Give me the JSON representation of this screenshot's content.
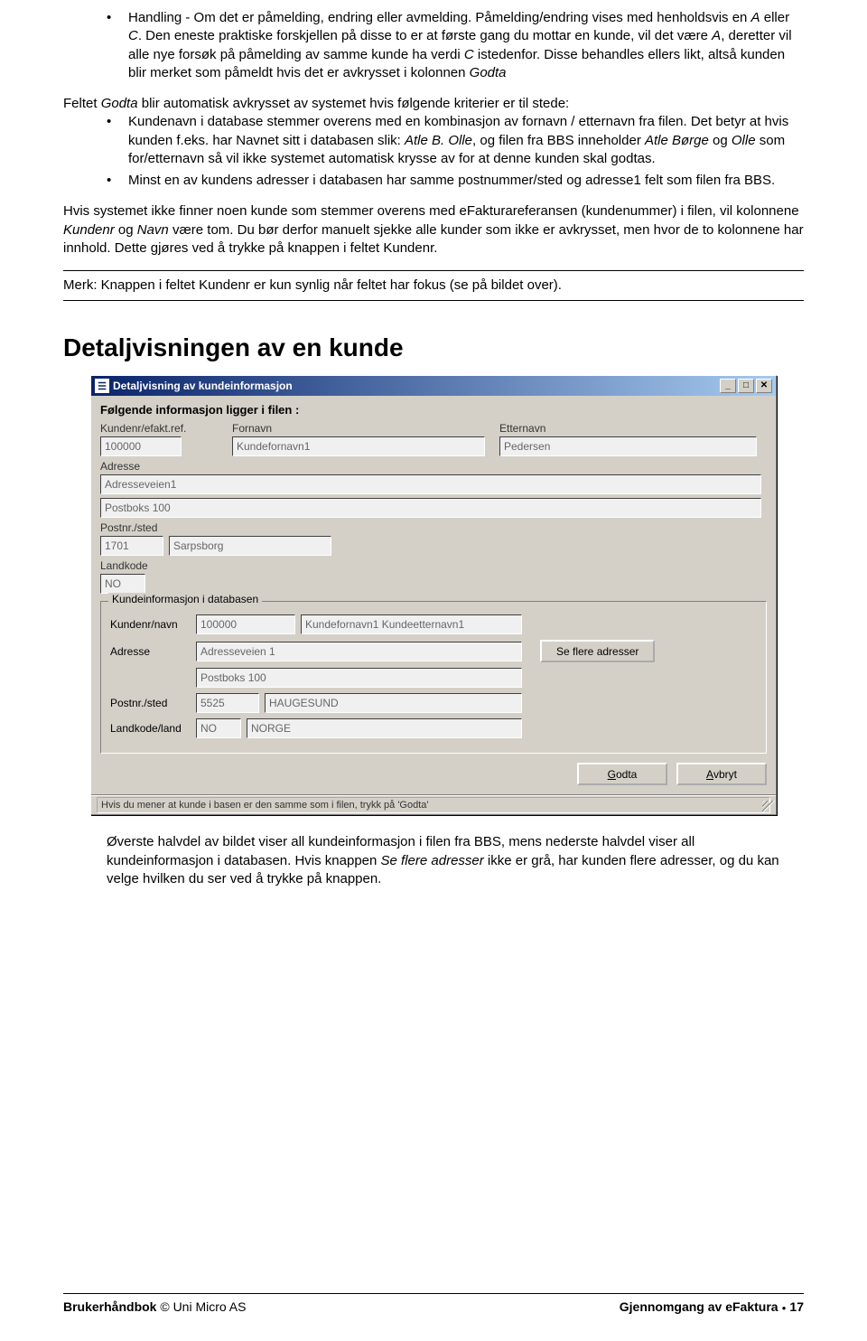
{
  "bullets_top": [
    {
      "pre": "",
      "parts": [
        "Handling - Om det er påmelding, endring eller avmelding. Påmelding/endring vises med henholdsvis en ",
        "A",
        " eller ",
        "C",
        ". Den eneste praktiske forskjellen på disse to er at første gang du mottar en kunde, vil det være ",
        "A",
        ", deretter vil alle nye forsøk på påmelding av samme kunde ha verdi ",
        "C",
        " istedenfor. Disse behandles ellers likt, altså kunden blir merket som påmeldt hvis det er avkrysset i kolonnen ",
        "Godta"
      ]
    }
  ],
  "para_feltet_pre": "Feltet ",
  "para_feltet_italic": "Godta",
  "para_feltet_post": " blir automatisk avkrysset av systemet hvis følgende kriterier er til stede:",
  "sub_bullets": [
    "Kundenavn i database stemmer overens med en kombinasjon av fornavn / etternavn fra filen. Det betyr at hvis kunden f.eks. har Navnet sitt i databasen slik: Atle B. Olle, og filen fra BBS inneholder Atle Børge og Olle som for/etternavn så vil ikke systemet automatisk krysse av for at denne kunden skal godtas.",
    "Minst en av kundens adresser i databasen har samme postnummer/sted og adresse1 felt som filen fra BBS."
  ],
  "sub_bullet0_italics": [
    "Atle B. Olle",
    "Atle Børge",
    "Olle"
  ],
  "para_hvis": {
    "p1": "Hvis systemet ikke finner noen kunde som stemmer overens med eFakturareferansen (kundenummer) i filen, vil kolonnene ",
    "i1": "Kundenr",
    "p2": " og ",
    "i2": "Navn",
    "p3": " være tom. Du bør derfor manuelt sjekke alle kunder som ikke er avkrysset, men hvor de to kolonnene har innhold. Dette gjøres ved å trykke på knappen i feltet Kundenr."
  },
  "merk_line": "Merk: Knappen i feltet Kundenr er kun synlig når feltet har fokus (se på bildet over).",
  "heading": "Detaljvisningen av en kunde",
  "window": {
    "title": "Detaljvisning av kundeinformasjon",
    "caption": "Følgende informasjon ligger i filen :",
    "labels": {
      "kundenr": "Kundenr/efakt.ref.",
      "fornavn": "Fornavn",
      "etternavn": "Etternavn",
      "adresse": "Adresse",
      "postnr": "Postnr./sted",
      "landkode": "Landkode",
      "group_title": "Kundeinformasjon i databasen",
      "kundenr_navn": "Kundenr/navn",
      "adresse2": "Adresse",
      "postnr2": "Postnr./sted",
      "landkode_land": "Landkode/land"
    },
    "values": {
      "kundenr": "100000",
      "fornavn": "Kundefornavn1",
      "etternavn": "Pedersen",
      "adresse1": "Adresseveien1",
      "adresse2": "Postboks 100",
      "postnr": "1701",
      "sted": "Sarpsborg",
      "landkode": "NO",
      "db_kundenr": "100000",
      "db_navn": "Kundefornavn1 Kundeetternavn1",
      "db_adresse1": "Adresseveien 1",
      "db_adresse2": "Postboks 100",
      "db_postnr": "5525",
      "db_sted": "HAUGESUND",
      "db_landkode": "NO",
      "db_land": "NORGE"
    },
    "buttons": {
      "se_flere": "Se flere adresser",
      "godta": "Godta",
      "avbryt": "Avbryt"
    },
    "status": "Hvis du mener at kunde i basen er den samme som i filen, trykk på 'Godta'"
  },
  "para_below": {
    "p1": "Øverste halvdel av bildet viser all kundeinformasjon i filen fra BBS, mens nederste halvdel viser all kundeinformasjon i databasen. Hvis knappen ",
    "i1": "Se flere adresser",
    "p2": " ikke er grå, har kunden flere adresser, og du kan velge hvilken du ser ved å trykke på knappen."
  },
  "footer": {
    "left_bold": "Brukerhåndbok",
    "left_rest": " © Uni Micro AS",
    "right_bold": "Gjennomgang av eFaktura",
    "page": "17"
  }
}
